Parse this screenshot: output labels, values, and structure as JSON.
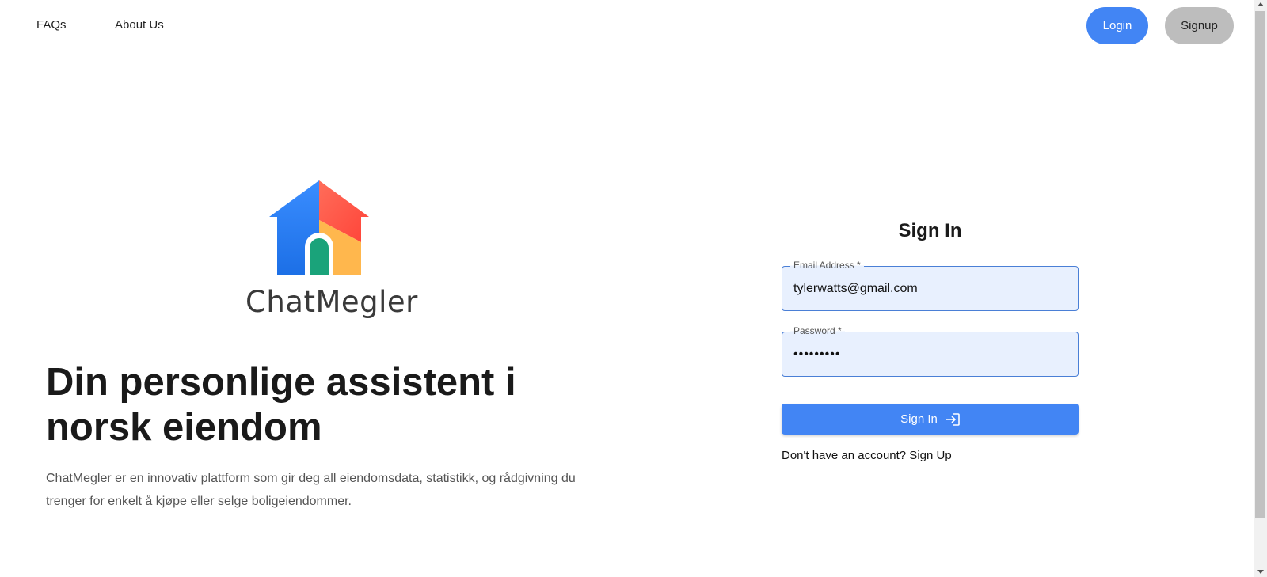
{
  "nav": {
    "faq_label": "FAQs",
    "about_label": "About Us",
    "login_label": "Login",
    "signup_label": "Signup"
  },
  "brand": {
    "name": "ChatMegler"
  },
  "hero": {
    "headline": "Din personlige assistent i norsk eiendom",
    "description": "ChatMegler er en innovativ plattform som gir deg all eiendomsdata, statistikk, og rådgivning du trenger for enkelt å kjøpe eller selge boligeiendommer."
  },
  "signin": {
    "title": "Sign In",
    "email_label": "Email Address *",
    "email_value": "tylerwatts@gmail.com",
    "password_label": "Password *",
    "password_value": "•••••••••",
    "submit_label": "Sign In",
    "submit_icon": "login-icon",
    "signup_prompt": "Don't have an account? Sign Up"
  },
  "colors": {
    "primary": "#4285f4",
    "secondary_button": "#bdbdbd",
    "field_background": "#e8f0fe",
    "logo_blue": "#2a7ff0",
    "logo_red": "#ff5a4e",
    "logo_yellow": "#ffb74d",
    "logo_green": "#1aa37a"
  }
}
